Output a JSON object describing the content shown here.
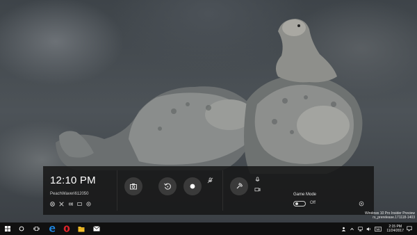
{
  "game_bar": {
    "time": "12:10 PM",
    "gamertag": "PeachWaveri612050",
    "game_mode_label": "Game Mode",
    "game_mode_state": "Off"
  },
  "watermark": {
    "line1": "Windows 10 Pro Insider Preview",
    "line2": "rs_prerelease.171118-1403"
  },
  "taskbar": {
    "clock_time": "2:15 PM",
    "clock_date": "11/24/2017"
  },
  "colors": {
    "gamebar_bg": "#161616",
    "edge_blue": "#1e88e5",
    "opera_red": "#e0242b",
    "folder_yellow": "#f4c02c"
  },
  "icons": {
    "start": "windows-start-icon",
    "search": "cortana-circle-icon",
    "task_view": "task-view-icon",
    "edge": "edge-browser-icon",
    "opera": "opera-browser-icon",
    "explorer": "file-explorer-icon",
    "mail": "mail-icon"
  }
}
